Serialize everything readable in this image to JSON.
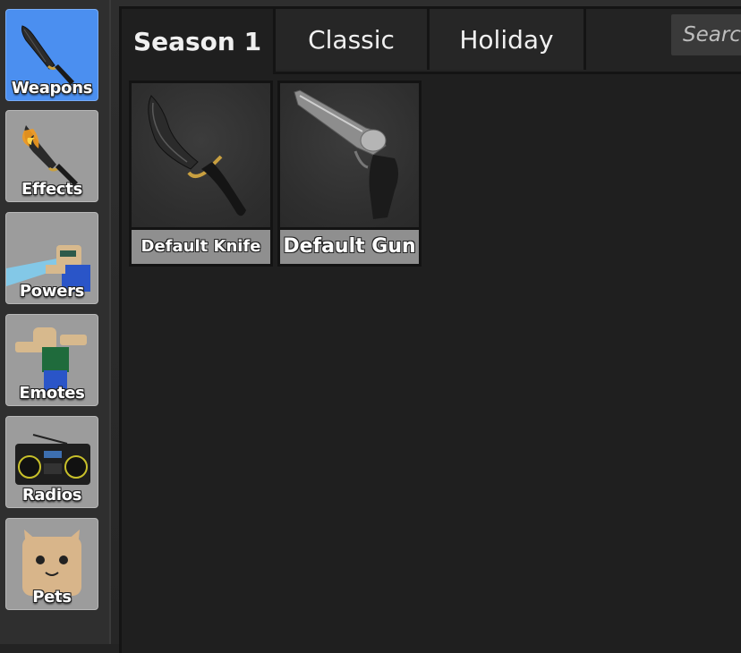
{
  "sidebar": {
    "items": [
      {
        "label": "Weapons",
        "icon": "knife-icon",
        "active": true
      },
      {
        "label": "Effects",
        "icon": "flaming-knife-icon",
        "active": false
      },
      {
        "label": "Powers",
        "icon": "powers-avatar-icon",
        "active": false
      },
      {
        "label": "Emotes",
        "icon": "emote-avatar-icon",
        "active": false
      },
      {
        "label": "Radios",
        "icon": "boombox-icon",
        "active": false
      },
      {
        "label": "Pets",
        "icon": "cat-pet-icon",
        "active": false
      }
    ]
  },
  "tabs": [
    {
      "label": "Season 1",
      "active": true
    },
    {
      "label": "Classic",
      "active": false
    },
    {
      "label": "Holiday",
      "active": false
    }
  ],
  "search": {
    "placeholder": "Search"
  },
  "items": [
    {
      "name": "Default Knife",
      "icon": "default-knife-icon"
    },
    {
      "name": "Default Gun",
      "icon": "revolver-icon"
    }
  ],
  "colors": {
    "active_tab_bg": "#4b8ff0",
    "inactive_tab_bg": "#9c9c9c",
    "panel_bg": "#1f1f1f"
  }
}
